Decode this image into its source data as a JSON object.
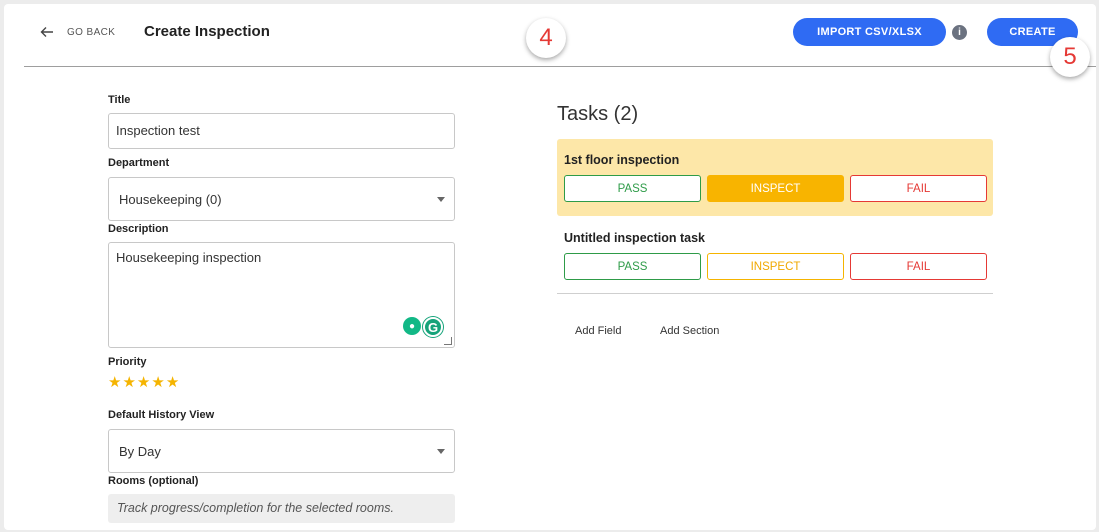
{
  "header": {
    "back_label": "GO BACK",
    "title": "Create Inspection",
    "import_label": "IMPORT CSV/XLSX",
    "info_glyph": "i",
    "create_label": "CREATE"
  },
  "badges": {
    "step_a": "4",
    "step_b": "5"
  },
  "form": {
    "title_label": "Title",
    "title_value": "Inspection test",
    "department_label": "Department",
    "department_value": "Housekeeping (0)",
    "description_label": "Description",
    "description_value": "Housekeeping inspection",
    "priority_label": "Priority",
    "priority_stars": 5,
    "history_label": "Default History View",
    "history_value": "By Day",
    "rooms_label": "Rooms (optional)",
    "rooms_placeholder": "Track progress/completion for the selected rooms."
  },
  "tasks": {
    "title": "Tasks  (2)",
    "items": [
      {
        "name": "1st floor inspection",
        "pass": "PASS",
        "inspect": "INSPECT",
        "fail": "FAIL",
        "selected": "inspect"
      },
      {
        "name": "Untitled inspection task",
        "pass": "PASS",
        "inspect": "INSPECT",
        "fail": "FAIL",
        "selected": ""
      }
    ],
    "add_field": "Add Field",
    "add_section": "Add Section"
  },
  "colors": {
    "primary": "#2f6bf3",
    "pass": "#2e9b48",
    "inspect": "#f5b400",
    "fail": "#e53935",
    "highlight": "#fde7a8"
  }
}
